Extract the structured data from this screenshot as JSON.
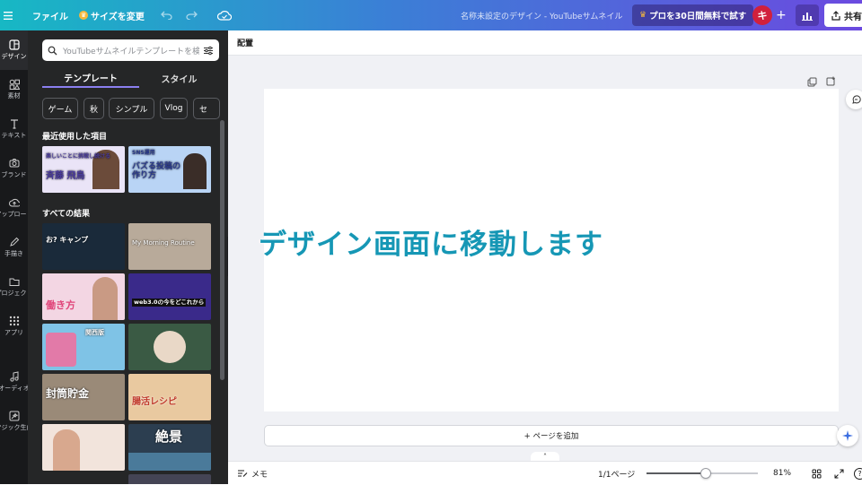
{
  "topbar": {
    "menu_icon": "hamburger-icon",
    "file_label": "ファイル",
    "resize_label": "サイズを変更",
    "title": "名称未設定のデザイン - YouTubeサムネイル",
    "pro_label": "プロを30日間無料で試す",
    "avatar_letter": "キ",
    "share_label": "共有"
  },
  "rail": {
    "items": [
      {
        "label": "デザイン",
        "icon": "design-icon"
      },
      {
        "label": "素材",
        "icon": "elements-icon"
      },
      {
        "label": "テキスト",
        "icon": "text-icon"
      },
      {
        "label": "ブランド",
        "icon": "brand-icon"
      },
      {
        "label": "アップロード",
        "icon": "upload-icon"
      },
      {
        "label": "手描き",
        "icon": "draw-icon"
      },
      {
        "label": "プロジェクト",
        "icon": "folder-icon"
      },
      {
        "label": "アプリ",
        "icon": "apps-icon"
      },
      {
        "label": "オーディオ",
        "icon": "audio-icon"
      },
      {
        "label": "マジック生成",
        "icon": "magic-icon"
      }
    ]
  },
  "panel": {
    "search_placeholder": "YouTubeサムネイルテンプレートを検索",
    "tabs": [
      "テンプレート",
      "スタイル"
    ],
    "chips": [
      "ゲーム",
      "秋",
      "シンプル",
      "Vlog",
      "セ"
    ],
    "recent_title": "最近使用した項目",
    "all_title": "すべての結果",
    "recent": [
      {
        "text": "斉藤 飛鳥",
        "sub": "楽しいことに挑戦し続ける",
        "bg": "#eae4f7",
        "fg": "#4a3b9c"
      },
      {
        "text": "バズる投稿の作り方",
        "sub": "SNS運用",
        "bg": "#b9d4f5",
        "fg": "#2a3a8c"
      }
    ],
    "results": [
      {
        "text": "お? キャンプ",
        "bg": "#1a2a3a",
        "fg": "#ffffff"
      },
      {
        "text": "My Morning Routine",
        "bg": "#b8aa9a",
        "fg": "#ffffff"
      },
      {
        "text": "働き方",
        "bg": "#f3d6e3",
        "fg": "#e0457a"
      },
      {
        "text": "web3.0の今をどこれから",
        "bg": "#3a2a8a",
        "fg": "#ffffff"
      },
      {
        "text": "関西版",
        "bg": "#7fc3e6",
        "fg": "#ffffff"
      },
      {
        "text": "",
        "bg": "#3a5a44",
        "fg": "#ffffff"
      },
      {
        "text": "封筒貯金",
        "bg": "#9a8a78",
        "fg": "#ffffff"
      },
      {
        "text": "腸活レシピ",
        "bg": "#e9c9a0",
        "fg": "#c0392b"
      },
      {
        "text": "",
        "bg": "#f2e4dc",
        "fg": "#ffffff"
      },
      {
        "text": "絶景",
        "bg": "#2c3e50",
        "fg": "#ffffff"
      }
    ]
  },
  "workspace": {
    "top_label": "配置",
    "overlay": "デザイン画面に移動します",
    "add_page": "+ ページを追加"
  },
  "bottom": {
    "notes_label": "メモ",
    "page_count": "1/1ページ",
    "zoom_label": "81%",
    "zoom_percent": 81
  }
}
